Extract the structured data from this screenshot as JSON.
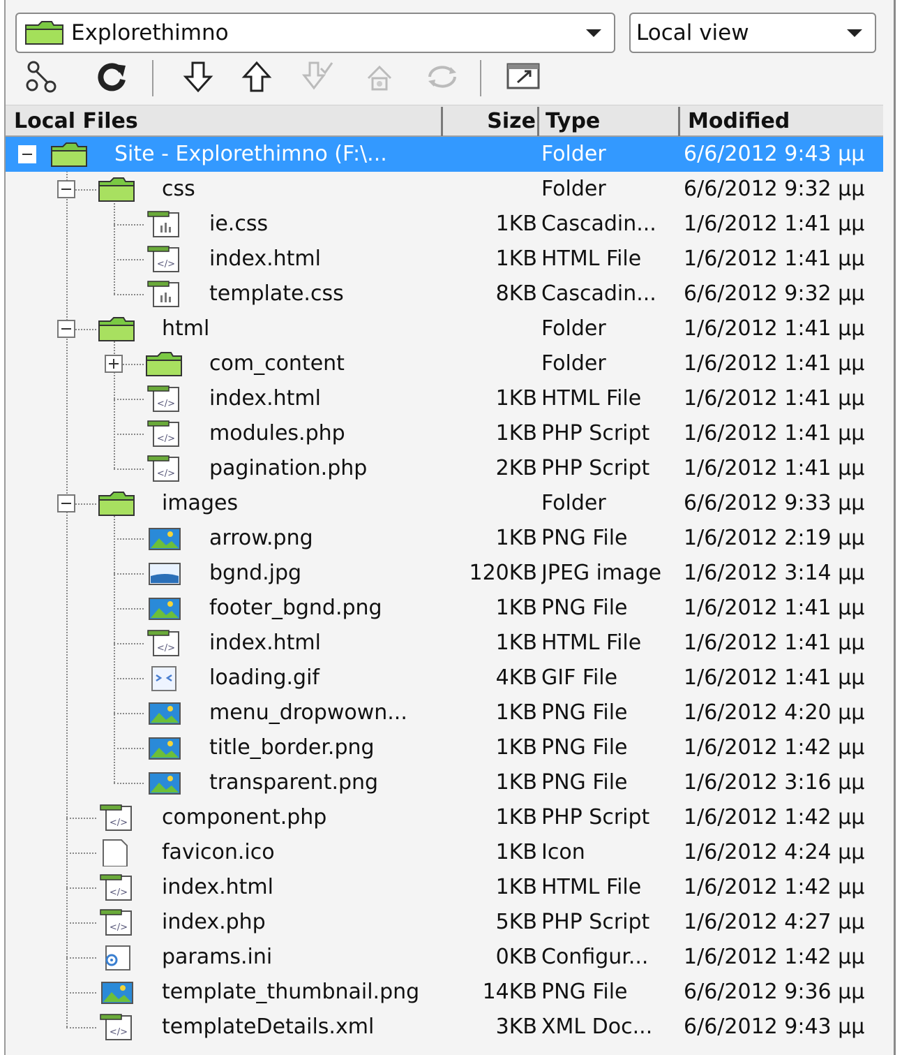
{
  "site_selector": {
    "value": "Explorethimno",
    "icon": "folder-icon"
  },
  "view_selector": {
    "value": "Local view"
  },
  "toolbar": [
    {
      "name": "connect-button",
      "icon": "connect-icon",
      "enabled": true
    },
    {
      "name": "refresh-button",
      "icon": "refresh-icon",
      "enabled": true
    },
    {
      "name": "get-button",
      "icon": "down-arrow-icon",
      "enabled": true
    },
    {
      "name": "put-button",
      "icon": "up-arrow-icon",
      "enabled": true
    },
    {
      "name": "check-out-button",
      "icon": "check-out-icon",
      "enabled": false
    },
    {
      "name": "check-in-button",
      "icon": "check-in-icon",
      "enabled": false
    },
    {
      "name": "synchronize-button",
      "icon": "sync-icon",
      "enabled": false
    },
    {
      "name": "expand-button",
      "icon": "expand-icon",
      "enabled": true
    }
  ],
  "columns": {
    "name": "Local Files",
    "size": "Size",
    "type": "Type",
    "modified": "Modified"
  },
  "rows": [
    {
      "name": "Site - Explorethimno (F:\\...",
      "size": "",
      "type": "Folder",
      "modified": "6/6/2012 9:43 μμ",
      "level": 0,
      "icon": "folder",
      "toggle": "minus",
      "selected": true
    },
    {
      "name": "css",
      "size": "",
      "type": "Folder",
      "modified": "6/6/2012 9:32 μμ",
      "level": 1,
      "icon": "folder",
      "toggle": "minus"
    },
    {
      "name": "ie.css",
      "size": "1KB",
      "type": "Cascadin...",
      "modified": "1/6/2012 1:41 μμ",
      "level": 2,
      "icon": "css"
    },
    {
      "name": "index.html",
      "size": "1KB",
      "type": "HTML File",
      "modified": "1/6/2012 1:41 μμ",
      "level": 2,
      "icon": "code"
    },
    {
      "name": "template.css",
      "size": "8KB",
      "type": "Cascadin...",
      "modified": "6/6/2012 9:32 μμ",
      "level": 2,
      "icon": "css"
    },
    {
      "name": "html",
      "size": "",
      "type": "Folder",
      "modified": "1/6/2012 1:41 μμ",
      "level": 1,
      "icon": "folder",
      "toggle": "minus"
    },
    {
      "name": "com_content",
      "size": "",
      "type": "Folder",
      "modified": "1/6/2012 1:41 μμ",
      "level": 2,
      "icon": "folder",
      "toggle": "plus"
    },
    {
      "name": "index.html",
      "size": "1KB",
      "type": "HTML File",
      "modified": "1/6/2012 1:41 μμ",
      "level": 2,
      "icon": "code"
    },
    {
      "name": "modules.php",
      "size": "1KB",
      "type": "PHP Script",
      "modified": "1/6/2012 1:41 μμ",
      "level": 2,
      "icon": "code"
    },
    {
      "name": "pagination.php",
      "size": "2KB",
      "type": "PHP Script",
      "modified": "1/6/2012 1:41 μμ",
      "level": 2,
      "icon": "code"
    },
    {
      "name": "images",
      "size": "",
      "type": "Folder",
      "modified": "6/6/2012 9:33 μμ",
      "level": 1,
      "icon": "folder",
      "toggle": "minus"
    },
    {
      "name": "arrow.png",
      "size": "1KB",
      "type": "PNG File",
      "modified": "1/6/2012 2:19 μμ",
      "level": 2,
      "icon": "image"
    },
    {
      "name": "bgnd.jpg",
      "size": "120KB",
      "type": "JPEG image",
      "modified": "1/6/2012 3:14 μμ",
      "level": 2,
      "icon": "jpeg"
    },
    {
      "name": "footer_bgnd.png",
      "size": "1KB",
      "type": "PNG File",
      "modified": "1/6/2012 1:41 μμ",
      "level": 2,
      "icon": "image"
    },
    {
      "name": "index.html",
      "size": "1KB",
      "type": "HTML File",
      "modified": "1/6/2012 1:41 μμ",
      "level": 2,
      "icon": "code"
    },
    {
      "name": "loading.gif",
      "size": "4KB",
      "type": "GIF File",
      "modified": "1/6/2012 1:41 μμ",
      "level": 2,
      "icon": "gif"
    },
    {
      "name": "menu_dropwown...",
      "size": "1KB",
      "type": "PNG File",
      "modified": "1/6/2012 4:20 μμ",
      "level": 2,
      "icon": "image"
    },
    {
      "name": "title_border.png",
      "size": "1KB",
      "type": "PNG File",
      "modified": "1/6/2012 1:42 μμ",
      "level": 2,
      "icon": "image"
    },
    {
      "name": "transparent.png",
      "size": "1KB",
      "type": "PNG File",
      "modified": "1/6/2012 3:16 μμ",
      "level": 2,
      "icon": "image"
    },
    {
      "name": "component.php",
      "size": "1KB",
      "type": "PHP Script",
      "modified": "1/6/2012 1:42 μμ",
      "level": 1,
      "icon": "code"
    },
    {
      "name": "favicon.ico",
      "size": "1KB",
      "type": "Icon",
      "modified": "1/6/2012 4:24 μμ",
      "level": 1,
      "icon": "blank"
    },
    {
      "name": "index.html",
      "size": "1KB",
      "type": "HTML File",
      "modified": "1/6/2012 1:42 μμ",
      "level": 1,
      "icon": "code"
    },
    {
      "name": "index.php",
      "size": "5KB",
      "type": "PHP Script",
      "modified": "1/6/2012 4:27 μμ",
      "level": 1,
      "icon": "code"
    },
    {
      "name": "params.ini",
      "size": "0KB",
      "type": "Configur...",
      "modified": "1/6/2012 1:42 μμ",
      "level": 1,
      "icon": "config"
    },
    {
      "name": "template_thumbnail.png",
      "size": "14KB",
      "type": "PNG File",
      "modified": "6/6/2012 9:36 μμ",
      "level": 1,
      "icon": "image"
    },
    {
      "name": "templateDetails.xml",
      "size": "3KB",
      "type": "XML Doc...",
      "modified": "6/6/2012 9:43 μμ",
      "level": 1,
      "icon": "code"
    }
  ]
}
